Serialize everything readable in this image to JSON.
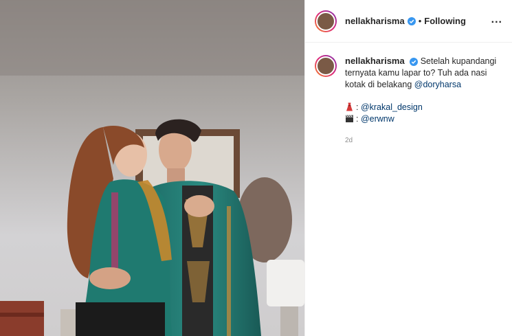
{
  "post": {
    "username": "nellakharisma",
    "follow_dot": "•",
    "follow_status": "Following",
    "more_label": "...",
    "caption": "Setelah kupandangi ternyata kamu lapar to? Tuh ada nasi kotak di belakang",
    "caption_mention": "@doryharsa",
    "credit1_prefix": ": ",
    "credit1_mention": "@krakal_design",
    "credit2_prefix": ": ",
    "credit2_mention": "@erwnw",
    "timestamp": "2d"
  },
  "icons": {
    "verified": "verified-badge-icon",
    "more": "more-options-icon",
    "dress": "dress-emoji",
    "clapper": "clapper-board-emoji"
  },
  "colors": {
    "verified_blue": "#3897f0",
    "mention_blue": "#00376b",
    "text_dark": "#262626",
    "muted_gray": "#8e8e8e"
  }
}
